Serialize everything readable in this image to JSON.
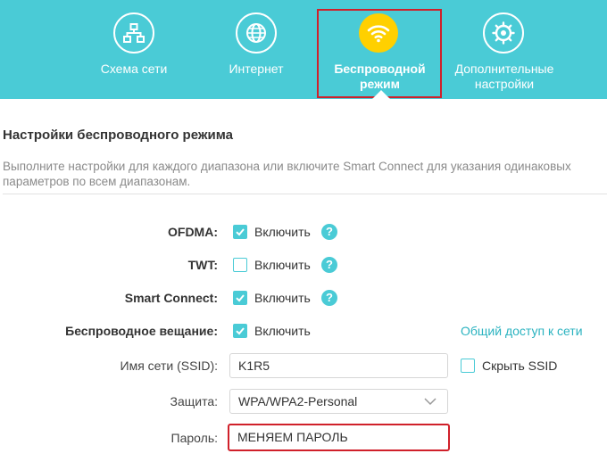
{
  "nav": {
    "items": [
      {
        "label": "Схема сети",
        "icon": "network-topology-icon"
      },
      {
        "label": "Интернет",
        "icon": "globe-icon"
      },
      {
        "label": "Беспроводной режим",
        "icon": "wifi-icon",
        "active": true
      },
      {
        "label": "Дополнительные настройки",
        "icon": "gear-icon"
      }
    ]
  },
  "section": {
    "title": "Настройки беспроводного режима",
    "description": "Выполните настройки для каждого диапазона или включите Smart Connect для указания одинаковых параметров по всем диапазонам."
  },
  "settings": {
    "ofdma": {
      "label": "OFDMA",
      "option": "Включить",
      "checked": true
    },
    "twt": {
      "label": "TWT",
      "option": "Включить",
      "checked": false
    },
    "smart_connect": {
      "label": "Smart Connect",
      "option": "Включить",
      "checked": true
    },
    "broadcast": {
      "label": "Беспроводное вещание",
      "option": "Включить",
      "checked": true,
      "link": "Общий доступ к сети"
    },
    "ssid": {
      "label": "Имя сети (SSID)",
      "value": "K1R5",
      "hide_label": "Скрыть SSID",
      "hide_checked": false
    },
    "security": {
      "label": "Защита",
      "value": "WPA/WPA2-Personal"
    },
    "password": {
      "label": "Пароль",
      "value": "МЕНЯЕМ ПАРОЛЬ"
    }
  },
  "colors": {
    "accent": "#4acbd6",
    "active_icon": "#ffd000",
    "highlight": "#d0202a"
  }
}
